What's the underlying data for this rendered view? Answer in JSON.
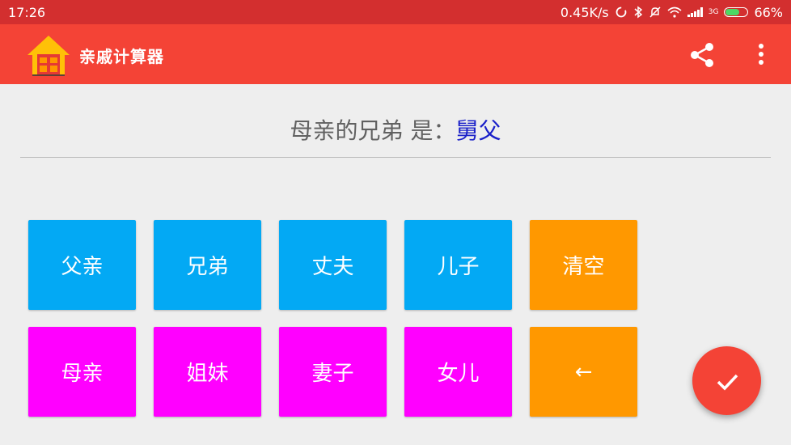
{
  "status_bar": {
    "time": "17:26",
    "net_speed": "0.45K/s",
    "signal_type": "3G",
    "battery": "66%",
    "battery_level": 0.66,
    "icons": [
      "sync-icon",
      "bluetooth-icon",
      "mute-icon",
      "wifi-icon",
      "signal-icon",
      "battery-icon"
    ]
  },
  "app_bar": {
    "title": "亲戚计算器",
    "logo": "house-logo-icon",
    "actions": [
      "share-icon",
      "more-vert-icon"
    ]
  },
  "result": {
    "query": "母亲的兄弟",
    "separator": " 是：",
    "answer": "舅父"
  },
  "keys": {
    "father": "父亲",
    "brother": "兄弟",
    "husband": "丈夫",
    "son": "儿子",
    "clear": "清空",
    "mother": "母亲",
    "sister": "姐妹",
    "wife": "妻子",
    "daughter": "女儿",
    "backspace": "←"
  },
  "fab": {
    "icon": "check-icon"
  },
  "colors": {
    "status_bar": "#d32f2f",
    "app_bar": "#f44336",
    "male_key": "#03a9f4",
    "female_key": "#ff00ff",
    "action_key": "#ff9800",
    "answer_text": "#1a20c9",
    "fab": "#f44336"
  }
}
